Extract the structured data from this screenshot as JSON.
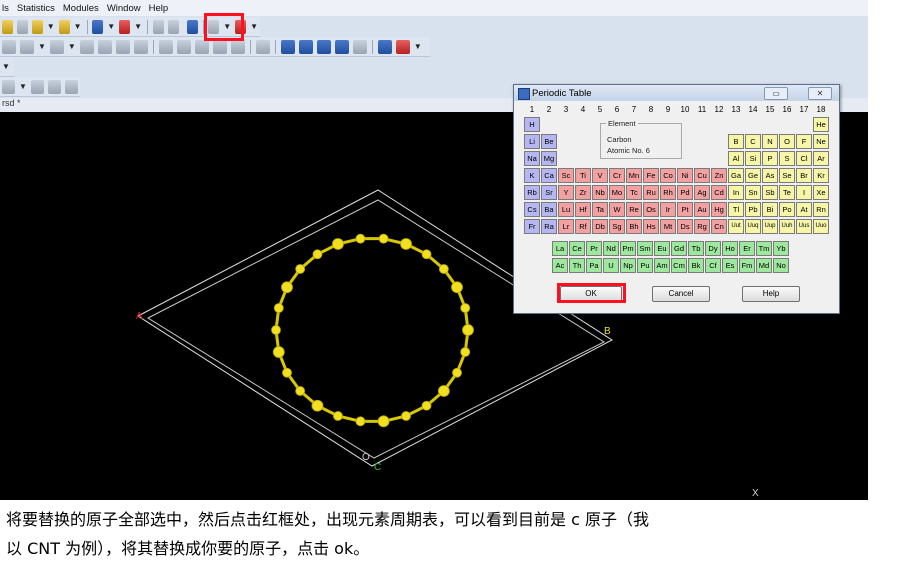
{
  "menu": [
    "ls",
    "Statistics",
    "Modules",
    "Window",
    "Help"
  ],
  "document_tab": "rsd *",
  "dialog": {
    "title": "Periodic Table",
    "groups": [
      "1",
      "2",
      "3",
      "4",
      "5",
      "6",
      "7",
      "8",
      "9",
      "10",
      "11",
      "12",
      "13",
      "14",
      "15",
      "16",
      "17",
      "18"
    ],
    "element_box": {
      "legend": "Element",
      "name": "Carbon",
      "number": "Atomic No. 6"
    },
    "rows": [
      [
        "H",
        "",
        "",
        "",
        "",
        "",
        "",
        "",
        "",
        "",
        "",
        "",
        "",
        "",
        "",
        "",
        "",
        "He"
      ],
      [
        "Li",
        "Be",
        "",
        "",
        "",
        "",
        "",
        "",
        "",
        "",
        "",
        "",
        "B",
        "C",
        "N",
        "O",
        "F",
        "Ne"
      ],
      [
        "Na",
        "Mg",
        "",
        "",
        "",
        "",
        "",
        "",
        "",
        "",
        "",
        "",
        "Al",
        "Si",
        "P",
        "S",
        "Cl",
        "Ar"
      ],
      [
        "K",
        "Ca",
        "Sc",
        "Ti",
        "V",
        "Cr",
        "Mn",
        "Fe",
        "Co",
        "Ni",
        "Cu",
        "Zn",
        "Ga",
        "Ge",
        "As",
        "Se",
        "Br",
        "Kr"
      ],
      [
        "Rb",
        "Sr",
        "Y",
        "Zr",
        "Nb",
        "Mo",
        "Tc",
        "Ru",
        "Rh",
        "Pd",
        "Ag",
        "Cd",
        "In",
        "Sn",
        "Sb",
        "Te",
        "I",
        "Xe"
      ],
      [
        "Cs",
        "Ba",
        "Lu",
        "Hf",
        "Ta",
        "W",
        "Re",
        "Os",
        "Ir",
        "Pt",
        "Au",
        "Hg",
        "Tl",
        "Pb",
        "Bi",
        "Po",
        "At",
        "Rn"
      ],
      [
        "Fr",
        "Ra",
        "Lr",
        "Rf",
        "Db",
        "Sg",
        "Bh",
        "Hs",
        "Mt",
        "Ds",
        "Rg",
        "Cn",
        "Uut",
        "Uuq",
        "Uup",
        "Uuh",
        "Uus",
        "Uuo"
      ]
    ],
    "lanthanides": [
      "La",
      "Ce",
      "Pr",
      "Nd",
      "Pm",
      "Sm",
      "Eu",
      "Gd",
      "Tb",
      "Dy",
      "Ho",
      "Er",
      "Tm",
      "Yb"
    ],
    "actinides": [
      "Ac",
      "Th",
      "Pa",
      "U",
      "Np",
      "Pu",
      "Am",
      "Cm",
      "Bk",
      "Cf",
      "Es",
      "Fm",
      "Md",
      "No"
    ],
    "ok_label": "OK",
    "cancel_label": "Cancel",
    "help_label": "Help"
  },
  "axes": {
    "a": "A",
    "b": "B",
    "o": "O",
    "c": "C",
    "x": "X"
  },
  "caption": {
    "line1": "将要替换的原子全部选中，然后点击红框处，出现元素周期表，可以看到目前是 c 原子（我",
    "line2": "以 CNT 为例），将其替换成你要的原子，点击 ok。"
  },
  "colors": {
    "highlight": "#ff1020",
    "atom": "#f0e020",
    "bond": "#d8c800",
    "cell": "#e0e0e0"
  }
}
